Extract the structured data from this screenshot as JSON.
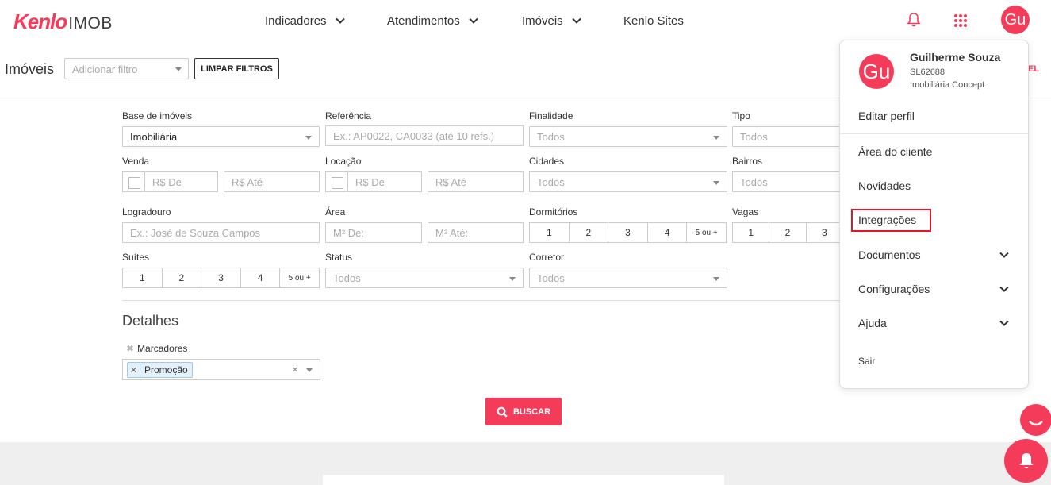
{
  "header": {
    "brand": "Kenlo",
    "product": "IMOB",
    "nav": [
      {
        "label": "Indicadores",
        "has_dropdown": true
      },
      {
        "label": "Atendimentos",
        "has_dropdown": true
      },
      {
        "label": "Imóveis",
        "has_dropdown": true
      },
      {
        "label": "Kenlo Sites",
        "has_dropdown": false
      }
    ],
    "avatar_initials": "Gu"
  },
  "subheader": {
    "title": "Imóveis",
    "filter_placeholder": "Adicionar filtro",
    "clear_button": "LIMPAR FILTROS",
    "cut_label": "EL"
  },
  "form": {
    "base": {
      "label": "Base de imóveis",
      "value": "Imobiliária"
    },
    "referencia": {
      "label": "Referência",
      "placeholder": "Ex.: AP0022, CA0033 (até 10 refs.)"
    },
    "finalidade": {
      "label": "Finalidade",
      "placeholder": "Todos"
    },
    "tipo": {
      "label": "Tipo",
      "placeholder": "Todos"
    },
    "venda": {
      "label": "Venda",
      "from": "R$ De",
      "to": "R$ Até"
    },
    "locacao": {
      "label": "Locação",
      "from": "R$ De",
      "to": "R$ Até"
    },
    "cidades": {
      "label": "Cidades",
      "placeholder": "Todos"
    },
    "bairros": {
      "label": "Bairros",
      "placeholder": "Todos"
    },
    "logradouro": {
      "label": "Logradouro",
      "placeholder": "Ex.: José de Souza Campos"
    },
    "area": {
      "label": "Área",
      "from": "M² De:",
      "to": "M² Até:"
    },
    "dormitorios": {
      "label": "Dormitórios",
      "options": [
        "1",
        "2",
        "3",
        "4",
        "5 ou +"
      ]
    },
    "vagas": {
      "label": "Vagas",
      "options": [
        "1",
        "2",
        "3"
      ]
    },
    "suites": {
      "label": "Suítes",
      "options": [
        "1",
        "2",
        "3",
        "4",
        "5 ou +"
      ]
    },
    "status": {
      "label": "Status",
      "placeholder": "Todos"
    },
    "corretor": {
      "label": "Corretor",
      "placeholder": "Todos"
    },
    "details_title": "Detalhes",
    "marcadores": {
      "label": "Marcadores",
      "tags": [
        "Promoção"
      ]
    },
    "search_button": "BUSCAR"
  },
  "user_menu": {
    "name": "Guilherme Souza",
    "code": "SL62688",
    "company": "Imobiliária Concept",
    "initials": "Gu",
    "items": {
      "edit_profile": "Editar perfil",
      "client_area": "Área do cliente",
      "news": "Novidades",
      "integrations": "Integrações",
      "documents": "Documentos",
      "settings": "Configurações",
      "help": "Ajuda",
      "logout": "Sair"
    }
  },
  "colors": {
    "brand": "#f43b5a",
    "highlight": "#e0162b"
  }
}
